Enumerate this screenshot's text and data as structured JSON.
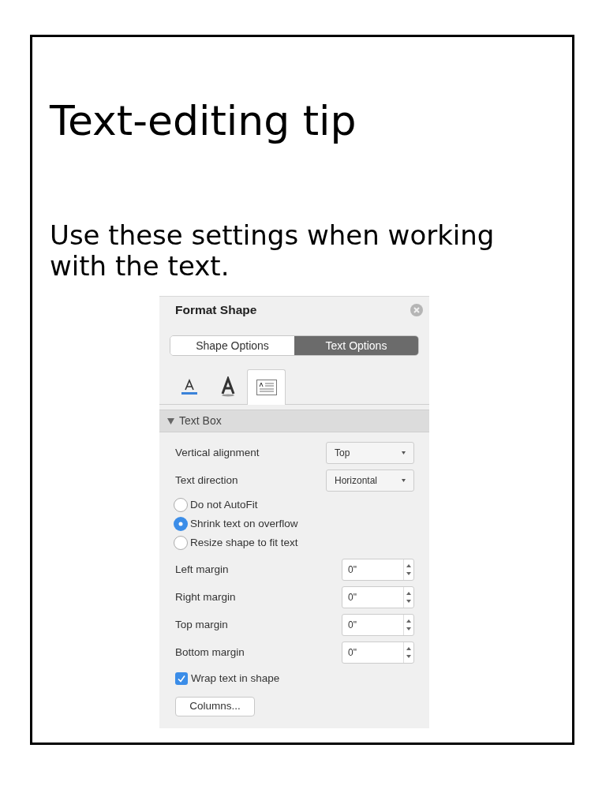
{
  "slide": {
    "title": "Text-editing tip",
    "body": "Use these settings when working with the text."
  },
  "panel": {
    "title": "Format Shape",
    "segments": [
      {
        "label": "Shape Options",
        "selected": false
      },
      {
        "label": "Text Options",
        "selected": true
      }
    ],
    "icon_tabs": [
      {
        "kind": "fill",
        "selected": false
      },
      {
        "kind": "effects",
        "selected": false
      },
      {
        "kind": "textbox",
        "selected": true
      }
    ],
    "section": {
      "label": "Text Box",
      "expanded": true
    },
    "dropdowns": [
      {
        "label": "Vertical alignment",
        "value": "Top"
      },
      {
        "label": "Text direction",
        "value": "Horizontal"
      }
    ],
    "autofit": [
      {
        "label": "Do not AutoFit",
        "selected": false
      },
      {
        "label": "Shrink text on overflow",
        "selected": true
      },
      {
        "label": "Resize shape to fit text",
        "selected": false
      }
    ],
    "margins": [
      {
        "label": "Left margin",
        "value": "0\""
      },
      {
        "label": "Right margin",
        "value": "0\""
      },
      {
        "label": "Top margin",
        "value": "0\""
      },
      {
        "label": "Bottom margin",
        "value": "0\""
      }
    ],
    "wrap": {
      "label": "Wrap text in shape",
      "checked": true
    },
    "columns_button": "Columns..."
  }
}
